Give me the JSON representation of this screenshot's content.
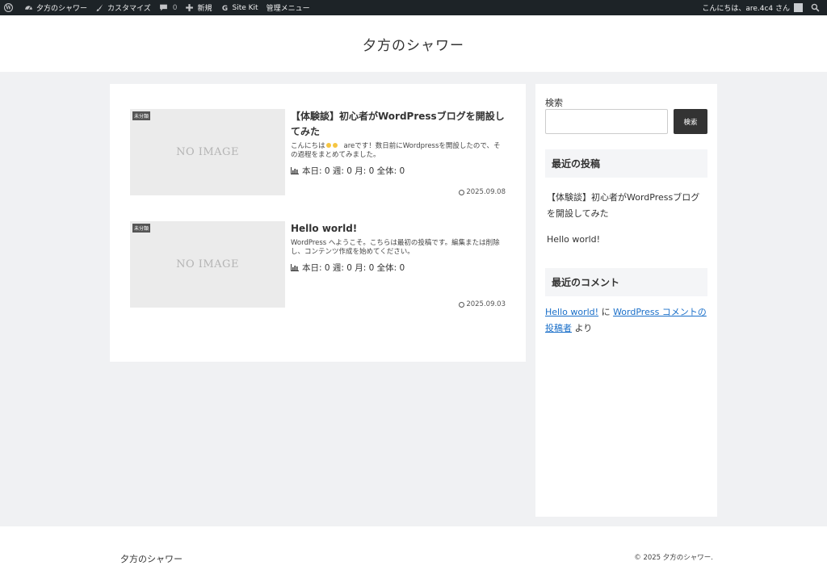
{
  "admin_bar": {
    "site_name": "夕方のシャワー",
    "customize": "カスタマイズ",
    "comments_count": "0",
    "new": "新規",
    "site_kit": "Site Kit",
    "admin_menu": "管理メニュー",
    "greeting": "こんにちは、are.4c4 さん"
  },
  "header": {
    "site_title": "夕方のシャワー"
  },
  "posts": [
    {
      "category": "未分類",
      "thumbnail_text": "NO IMAGE",
      "title": "【体験談】初心者がWordPressブログを開設してみた",
      "excerpt_pre": "こんにちは",
      "excerpt_post": "areです！数日前にWordpressを開設したので、その過程をまとめてみました。",
      "stats": "本日: 0 週: 0 月: 0 全体: 0",
      "date": "2025.09.08"
    },
    {
      "category": "未分類",
      "thumbnail_text": "NO IMAGE",
      "title": "Hello world!",
      "excerpt": "WordPress へようこそ。こちらは最初の投稿です。編集または削除し、コンテンツ作成を始めてください。",
      "stats": "本日: 0 週: 0 月: 0 全体: 0",
      "date": "2025.09.03"
    }
  ],
  "sidebar": {
    "search_label": "検索",
    "search_button": "検索",
    "recent_posts_title": "最近の投稿",
    "recent_posts": [
      "【体験談】初心者がWordPressブログを開設してみた",
      "Hello world!"
    ],
    "recent_comments_title": "最近のコメント",
    "comment": {
      "post_link": "Hello world!",
      "on": "に",
      "author_link": "WordPress コメントの投稿者",
      "suffix": "より"
    }
  },
  "footer": {
    "site_title": "夕方のシャワー",
    "copyright": "© 2025 夕方のシャワー."
  },
  "colors": {
    "admin_bar": "#1d2327",
    "page_bg": "#f0f1f3",
    "link": "#1a6fc9",
    "search_button": "#333333"
  }
}
